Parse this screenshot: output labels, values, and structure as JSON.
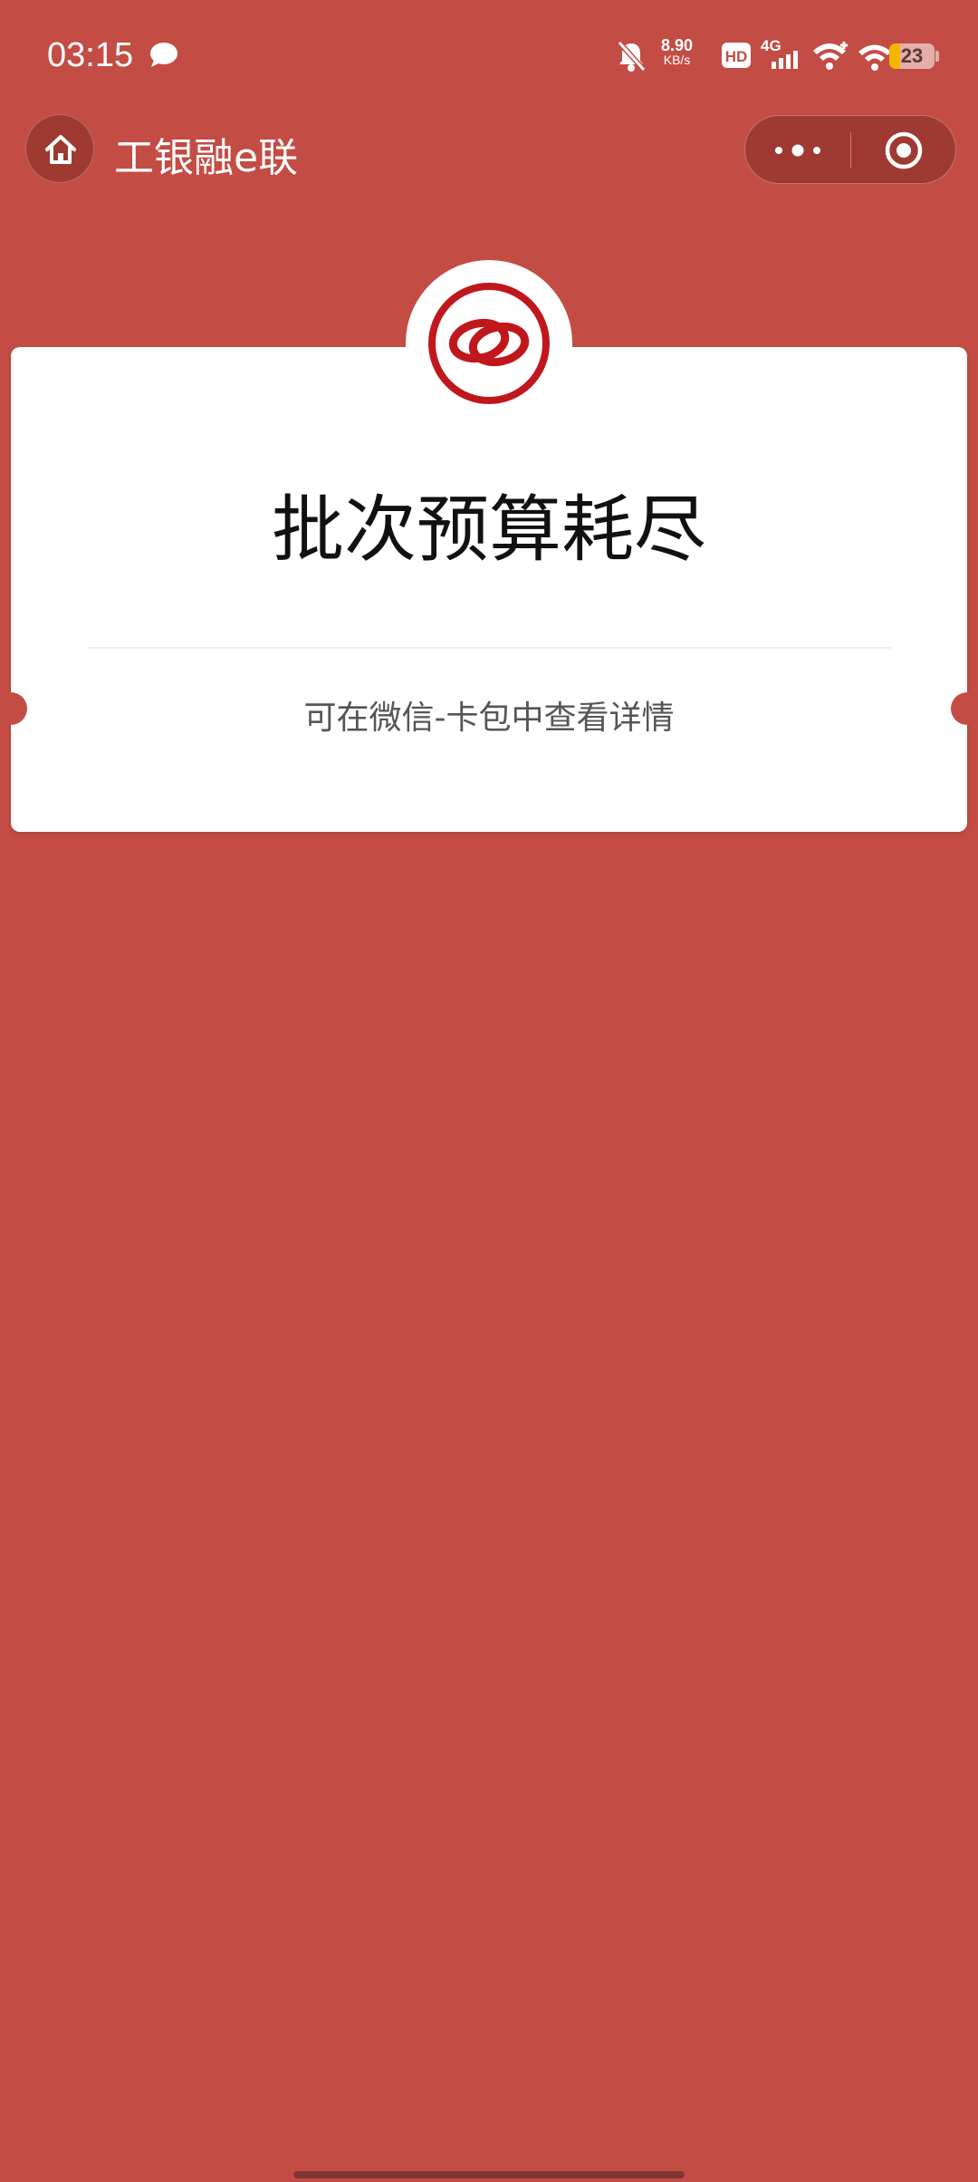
{
  "status_bar": {
    "time": "03:15",
    "network_speed_value": "8.90",
    "network_speed_unit": "KB/s",
    "hd_label": "HD",
    "signal_label": "4G",
    "battery_level": "23",
    "battery_fraction": 0.23,
    "icons": [
      "chat-icon",
      "mute-bell-icon",
      "hd-icon",
      "signal-4g-icon",
      "wifi-plus-icon",
      "wifi-icon",
      "battery-icon"
    ]
  },
  "nav": {
    "title": "工银融e联",
    "home_icon": "home-icon",
    "more_icon": "more-dots-icon",
    "close_icon": "target-close-icon"
  },
  "card": {
    "logo_icon": "icbc-rings-logo",
    "title": "批次预算耗尽",
    "subtitle": "可在微信-卡包中查看详情"
  },
  "colors": {
    "background": "#c34d45",
    "card": "#ffffff",
    "logo_red": "#c0171d",
    "title_text": "#111111",
    "subtitle_text": "#555555"
  }
}
